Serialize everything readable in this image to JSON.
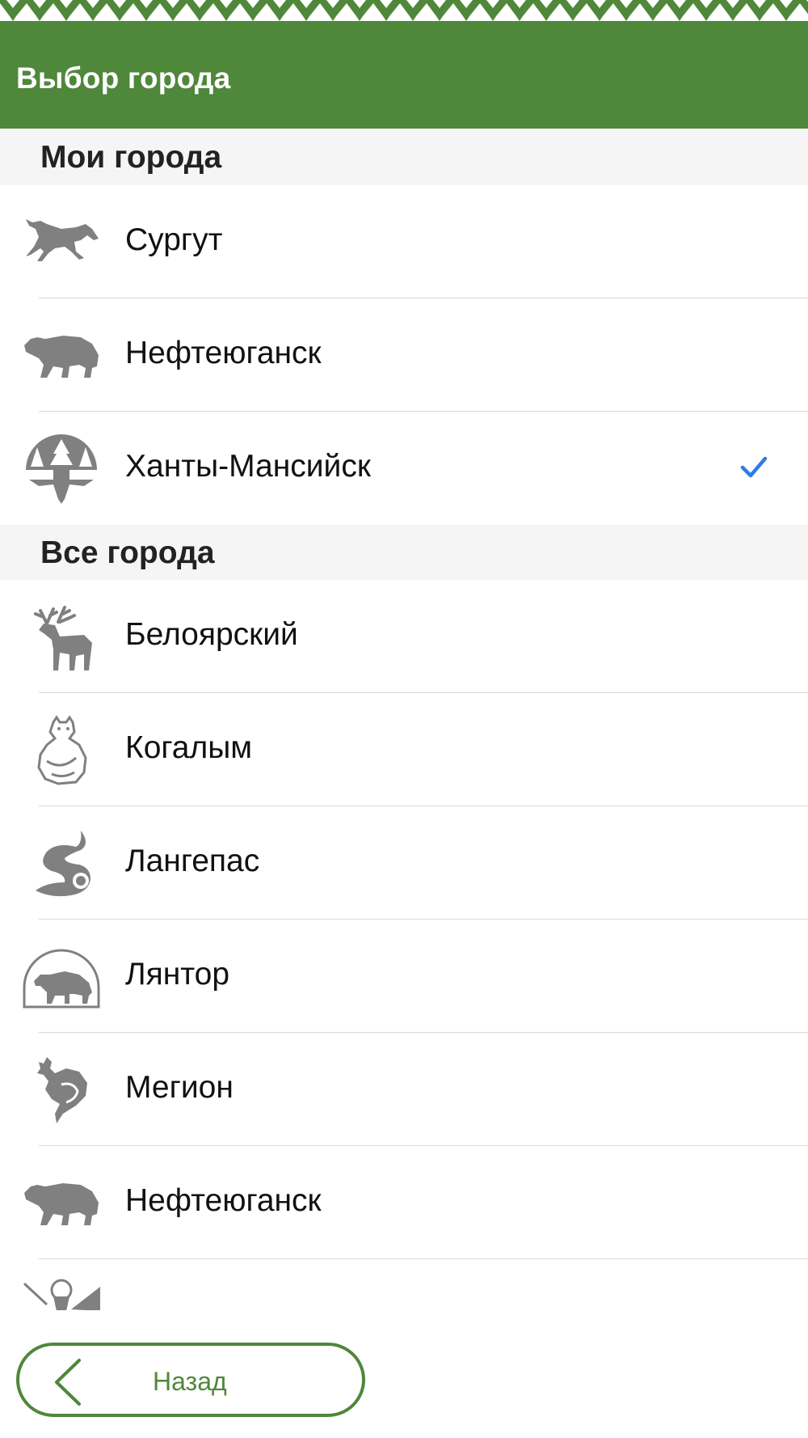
{
  "header": {
    "title": "Выбор города",
    "color": "#4f873b"
  },
  "sections": [
    {
      "title": "Мои города",
      "items": [
        {
          "label": "Сургут",
          "icon": "fox-icon",
          "selected": false
        },
        {
          "label": "Нефтеюганск",
          "icon": "bear-icon",
          "selected": false
        },
        {
          "label": "Ханты-Мансийск",
          "icon": "forest-emblem-icon",
          "selected": true
        }
      ]
    },
    {
      "title": "Все города",
      "items": [
        {
          "label": "Белоярский",
          "icon": "deer-icon"
        },
        {
          "label": "Когалым",
          "icon": "sitting-bear-icon"
        },
        {
          "label": "Лангепас",
          "icon": "squirrel-icon"
        },
        {
          "label": "Лянтор",
          "icon": "bear-arch-icon"
        },
        {
          "label": "Мегион",
          "icon": "bird-icon"
        },
        {
          "label": "Нефтеюганск",
          "icon": "bear-icon"
        },
        {
          "label": "",
          "icon": "mountain-emblem-icon"
        }
      ]
    }
  ],
  "footer": {
    "back_label": "Назад",
    "back_icon": "chevron-left-icon"
  },
  "colors": {
    "accent": "#4f873b",
    "check": "#2f7be6",
    "icon_gray": "#808080",
    "section_bg": "#f5f5f5"
  }
}
